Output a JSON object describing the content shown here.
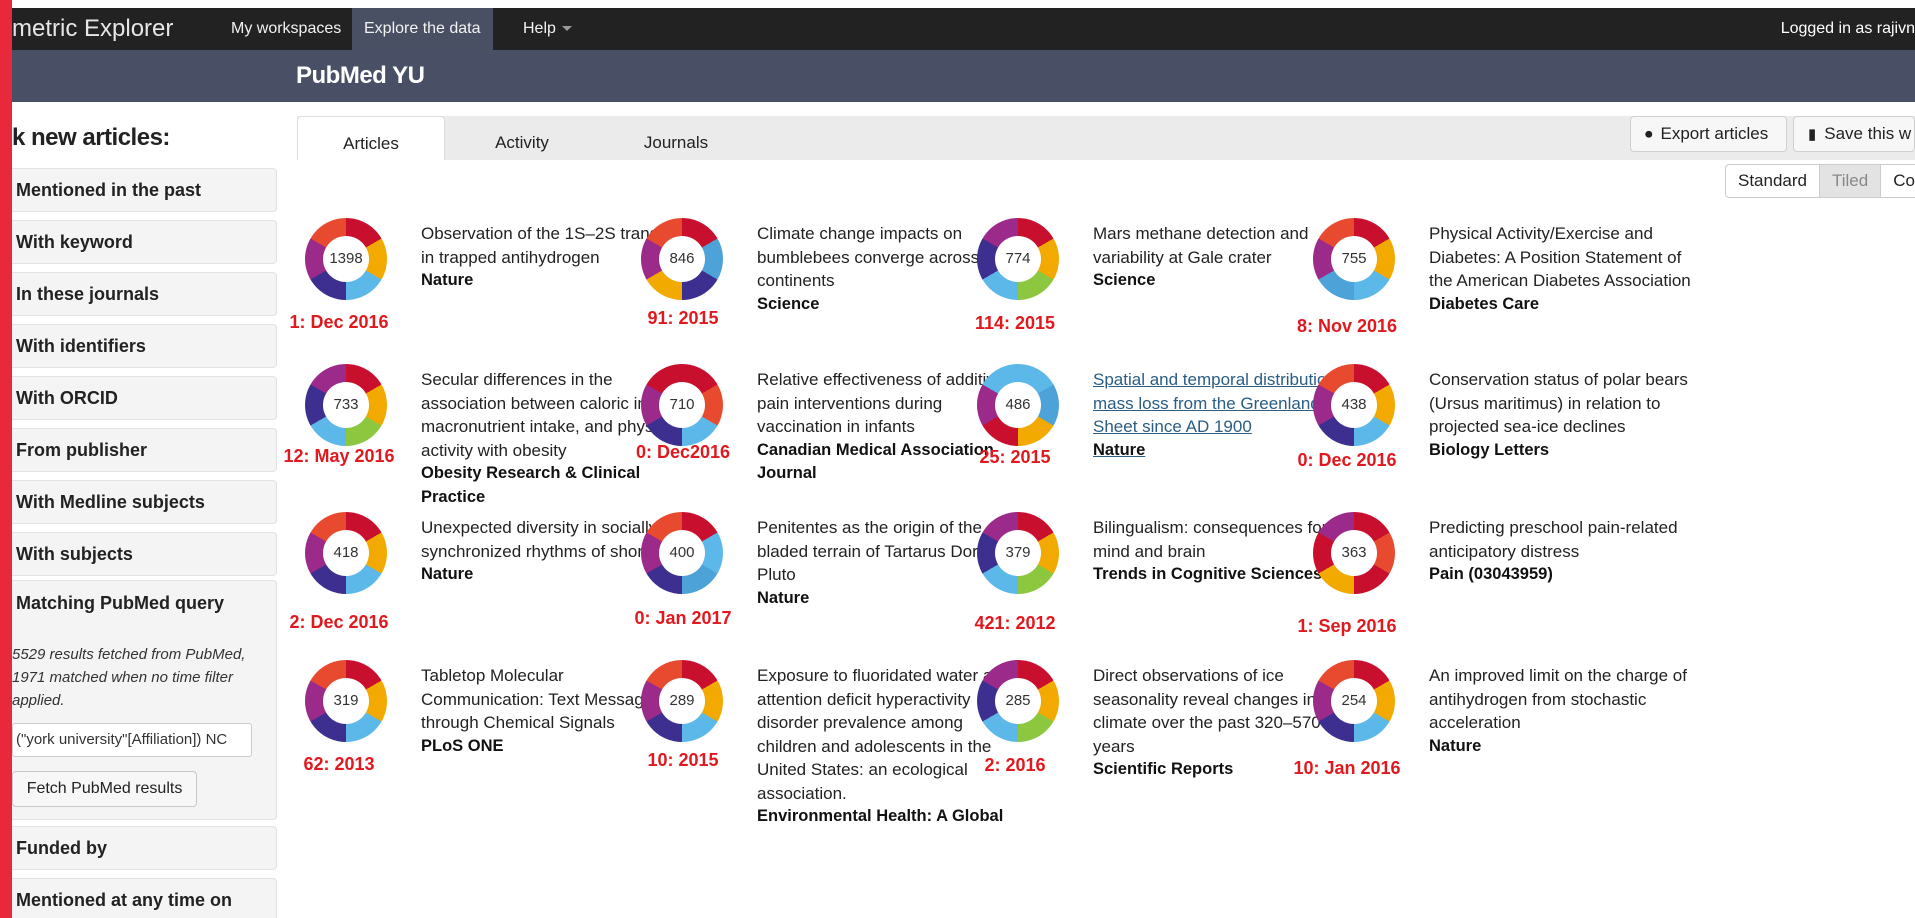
{
  "app": {
    "brand": "metric Explorer"
  },
  "nav": {
    "items": [
      {
        "label": "My workspaces",
        "active": false
      },
      {
        "label": "Explore the data",
        "active": true
      },
      {
        "label": "Help",
        "active": false
      }
    ],
    "logged_in": "Logged in as rajivn"
  },
  "workspace": {
    "title": "PubMed YU"
  },
  "sidebar": {
    "title": "k new articles:",
    "filters": [
      "Mentioned in the past",
      "With keyword",
      "In these journals",
      "With identifiers",
      "With ORCID",
      "From publisher",
      "With Medline subjects",
      "With subjects"
    ],
    "pubmed": {
      "title": "Matching PubMed query",
      "description": "5529 results fetched from PubMed, 1971 matched when no time filter applied.",
      "query_value": "(\"york university\"[Affiliation]) NC",
      "fetch_label": "Fetch PubMed results"
    },
    "lower_filters": [
      "Funded by",
      "Mentioned at any time on"
    ]
  },
  "tabs": [
    "Articles",
    "Activity",
    "Journals"
  ],
  "actions": {
    "export": "Export articles",
    "save": "Save this w"
  },
  "view": {
    "options": [
      "Standard",
      "Tiled",
      "Co"
    ],
    "selected": "Tiled"
  },
  "articles": [
    {
      "score": "1398",
      "title": "Observation of the 1S–2S transition in trapped antihydrogen",
      "journal": "Nature",
      "annotation": "1: Dec 2016",
      "link": false,
      "colors": [
        "#c8102e",
        "#f2a900",
        "#5bb8e8",
        "#3d2f8f",
        "#9b2a8a",
        "#e84a2f"
      ]
    },
    {
      "score": "846",
      "title": "Climate change impacts on bumblebees converge across continents",
      "journal": "Science",
      "annotation": "91: 2015",
      "link": false,
      "colors": [
        "#c8102e",
        "#4da2d8",
        "#3d2f8f",
        "#f2a900",
        "#9b2a8a",
        "#e84a2f"
      ]
    },
    {
      "score": "774",
      "title": "Mars methane detection and variability at Gale crater",
      "journal": "Science",
      "annotation": "114: 2015",
      "link": false,
      "colors": [
        "#c8102e",
        "#f2a900",
        "#8dc63f",
        "#5bb8e8",
        "#3d2f8f",
        "#9b2a8a"
      ]
    },
    {
      "score": "755",
      "title": "Physical Activity/Exercise and Diabetes: A Position Statement of the American Diabetes Association",
      "journal": "Diabetes Care",
      "annotation": "8: Nov 2016",
      "link": false,
      "colors": [
        "#c8102e",
        "#f2a900",
        "#5bb8e8",
        "#4da2d8",
        "#9b2a8a",
        "#e84a2f"
      ]
    },
    {
      "score": "733",
      "title": "Secular differences in the association between caloric intake, macronutrient intake, and physical activity with obesity",
      "journal": "Obesity Research & Clinical Practice",
      "annotation": "12: May 2016",
      "link": false,
      "colors": [
        "#c8102e",
        "#f2a900",
        "#8dc63f",
        "#5bb8e8",
        "#3d2f8f",
        "#9b2a8a"
      ]
    },
    {
      "score": "710",
      "title": "Relative effectiveness of additive pain interventions during vaccination in infants",
      "journal": "Canadian Medical Association Journal",
      "annotation": "0: Dec2016",
      "link": false,
      "colors": [
        "#c8102e",
        "#e84a2f",
        "#5bb8e8",
        "#3d2f8f",
        "#9b2a8a",
        "#c8102e"
      ]
    },
    {
      "score": "486",
      "title": "Spatial and temporal distribution of mass loss from the Greenland Ice Sheet since AD 1900",
      "journal": "Nature",
      "annotation": "25: 2015",
      "link": true,
      "colors": [
        "#5bb8e8",
        "#4da2d8",
        "#f2a900",
        "#c8102e",
        "#9b2a8a",
        "#5bb8e8"
      ]
    },
    {
      "score": "438",
      "title": "Conservation status of polar bears (Ursus maritimus) in relation to projected sea-ice declines",
      "journal": "Biology Letters",
      "annotation": "0: Dec 2016",
      "link": false,
      "colors": [
        "#c8102e",
        "#f2a900",
        "#5bb8e8",
        "#3d2f8f",
        "#9b2a8a",
        "#e84a2f"
      ]
    },
    {
      "score": "418",
      "title": "Unexpected diversity in socially synchronized rhythms of shorebirds",
      "journal": "Nature",
      "annotation": "2: Dec 2016",
      "link": false,
      "colors": [
        "#c8102e",
        "#f2a900",
        "#5bb8e8",
        "#3d2f8f",
        "#9b2a8a",
        "#e84a2f"
      ]
    },
    {
      "score": "400",
      "title": "Penitentes as the origin of the bladed terrain of Tartarus Dorsa on Pluto",
      "journal": "Nature",
      "annotation": "0: Jan 2017",
      "link": false,
      "colors": [
        "#c8102e",
        "#5bb8e8",
        "#4da2d8",
        "#3d2f8f",
        "#9b2a8a",
        "#e84a2f"
      ]
    },
    {
      "score": "379",
      "title": "Bilingualism: consequences for mind and brain",
      "journal": "Trends in Cognitive Sciences",
      "annotation": "421: 2012",
      "link": false,
      "colors": [
        "#c8102e",
        "#f2a900",
        "#8dc63f",
        "#5bb8e8",
        "#3d2f8f",
        "#9b2a8a"
      ]
    },
    {
      "score": "363",
      "title": "Predicting preschool pain-related anticipatory distress",
      "journal": "Pain (03043959)",
      "annotation": "1: Sep 2016",
      "link": false,
      "colors": [
        "#c8102e",
        "#e84a2f",
        "#c8102e",
        "#f2a900",
        "#c8102e",
        "#9b2a8a"
      ]
    },
    {
      "score": "319",
      "title": "Tabletop Molecular Communication: Text Messages through Chemical Signals",
      "journal": "PLoS ONE",
      "annotation": "62: 2013",
      "link": false,
      "colors": [
        "#c8102e",
        "#f2a900",
        "#5bb8e8",
        "#3d2f8f",
        "#9b2a8a",
        "#e84a2f"
      ]
    },
    {
      "score": "289",
      "title": "Exposure to fluoridated water and attention deficit hyperactivity disorder prevalence among children and adolescents in the United States: an ecological association.",
      "journal": "Environmental Health: A Global",
      "annotation": "10: 2015",
      "link": false,
      "colors": [
        "#c8102e",
        "#f2a900",
        "#5bb8e8",
        "#3d2f8f",
        "#9b2a8a",
        "#e84a2f"
      ]
    },
    {
      "score": "285",
      "title": "Direct observations of ice seasonality reveal changes in climate over the past 320–570 years",
      "journal": "Scientific Reports",
      "annotation": "2: 2016",
      "link": false,
      "colors": [
        "#c8102e",
        "#f2a900",
        "#8dc63f",
        "#5bb8e8",
        "#3d2f8f",
        "#9b2a8a"
      ]
    },
    {
      "score": "254",
      "title": "An improved limit on the charge of antihydrogen from stochastic acceleration",
      "journal": "Nature",
      "annotation": "10: Jan 2016",
      "link": false,
      "colors": [
        "#c8102e",
        "#f2a900",
        "#5bb8e8",
        "#3d2f8f",
        "#9b2a8a",
        "#e84a2f"
      ]
    }
  ],
  "colors": {
    "accent_red": "#e8293b",
    "annotation_red": "#e1191e",
    "nav_bg": "#222222",
    "subheader_bg": "#495065"
  }
}
